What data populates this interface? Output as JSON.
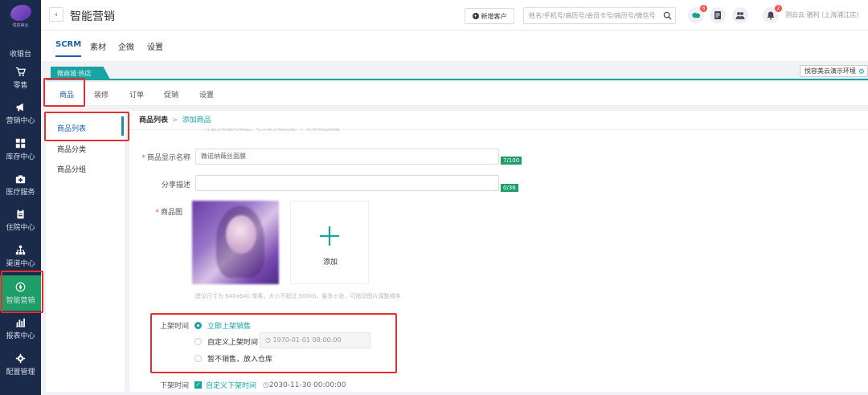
{
  "logo": {
    "text": "悦容美云"
  },
  "nav": [
    {
      "label": "收银台",
      "icon": "cashier-icon"
    },
    {
      "label": "零售",
      "icon": "cart-icon"
    },
    {
      "label": "营销中心",
      "icon": "megaphone-icon"
    },
    {
      "label": "库存中心",
      "icon": "grid-icon"
    },
    {
      "label": "医疗服务",
      "icon": "medkit-icon"
    },
    {
      "label": "住院中心",
      "icon": "clipboard-icon"
    },
    {
      "label": "渠道中心",
      "icon": "hierarchy-icon"
    },
    {
      "label": "智能营销",
      "icon": "compass-icon",
      "active": true
    },
    {
      "label": "报表中心",
      "icon": "bar-chart-icon"
    },
    {
      "label": "配置管理",
      "icon": "gear-icon"
    }
  ],
  "header": {
    "back": "‹",
    "title": "智能营销",
    "new_customer": "新增客户",
    "search_placeholder": "姓名/手机号/病历号/会员卡号/病历号/微信号",
    "badge_chat": "6",
    "badge_bell": "2",
    "user": "测云云·骆利 (上海浦江店)"
  },
  "subnav": [
    "SCRM",
    "素材",
    "企微",
    "设置"
  ],
  "shopbar": {
    "tag": "微商城·热店",
    "env": "悦容美云演示环境"
  },
  "module_tabs": [
    "商品",
    "装修",
    "订单",
    "促销",
    "设置"
  ],
  "side_menu": [
    "商品列表",
    "商品分类",
    "商品分组"
  ],
  "breadcrumb": {
    "current": "商品列表",
    "sep": ">",
    "next": "添加商品"
  },
  "form": {
    "hint_top": "开启分销后的商品，可关联分销员推广，获得商品佣金",
    "name_label": "商品显示名称",
    "name_value": "微诺纳薇丝面膜",
    "name_count": "7/100",
    "share_label": "分享描述",
    "share_value": "",
    "share_count": "0/36",
    "image_label": "商品图",
    "add_label": "添加",
    "image_hint": "建议尺寸为 640x640 像素，大小不超过 500kb，最多十张，可拖动图片调整顺序",
    "shelf_label": "上架时间",
    "shelf_opt1": "立即上架销售",
    "shelf_opt2": "自定义上架时间",
    "shelf_time": "1970-01-01 08:00:00",
    "shelf_opt3": "暂不销售，放入仓库",
    "off_label": "下架时间",
    "off_opt": "自定义下架时间",
    "off_time": "2030-11-30 00:00:00"
  },
  "colors": {
    "accent": "#1aa3a3",
    "nav_bg": "#1a2a4a",
    "active_nav": "#1e9e68",
    "highlight": "#e03131"
  }
}
